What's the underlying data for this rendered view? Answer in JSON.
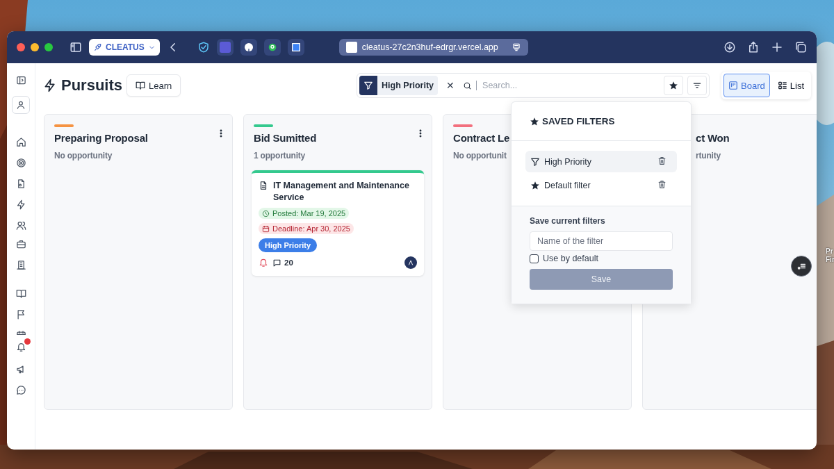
{
  "desktop": {
    "labels": [
      "Pr",
      "Fir"
    ]
  },
  "browser": {
    "workspace_button": "CLEATUS",
    "url": "cleatus-27c2n3huf-edrgr.vercel.app"
  },
  "sidebar": {
    "notification_badge": true
  },
  "page": {
    "title": "Pursuits",
    "learn_button": "Learn"
  },
  "filter_bar": {
    "active_filter": "High Priority",
    "clear": "✕",
    "search": {
      "placeholder": "Search..."
    }
  },
  "view_toggle": [
    {
      "label": "Board",
      "selected": true
    },
    {
      "label": "List",
      "selected": false
    }
  ],
  "columns": [
    {
      "title": "Preparing Proposal",
      "subtitle": "No opportunity",
      "color": "#f59342"
    },
    {
      "title": "Bid Sumitted",
      "subtitle": "1 opportunity",
      "color": "#34c98e",
      "cards": [
        {
          "title": "IT Management and Maintenance Service",
          "posted": "Posted: Mar 19, 2025",
          "deadline": "Deadline: Apr 30, 2025",
          "tag": "High Priority",
          "comments": "20"
        }
      ]
    },
    {
      "title": "Contract Le",
      "subtitle": "No opportunit",
      "color": "#f2707e"
    },
    {
      "title": "ct Won",
      "subtitle": "rtunity"
    }
  ],
  "saved_filters": {
    "title": "SAVED FILTERS",
    "items": [
      {
        "label": "High Priority",
        "kind": "filter",
        "selected": true
      },
      {
        "label": "Default filter",
        "kind": "default",
        "selected": false
      }
    ],
    "save_section": {
      "heading": "Save current filters",
      "placeholder": "Name of the filter",
      "checkbox": {
        "label": "Use by default",
        "checked": false
      },
      "button": "Save",
      "button_disabled": true
    }
  }
}
